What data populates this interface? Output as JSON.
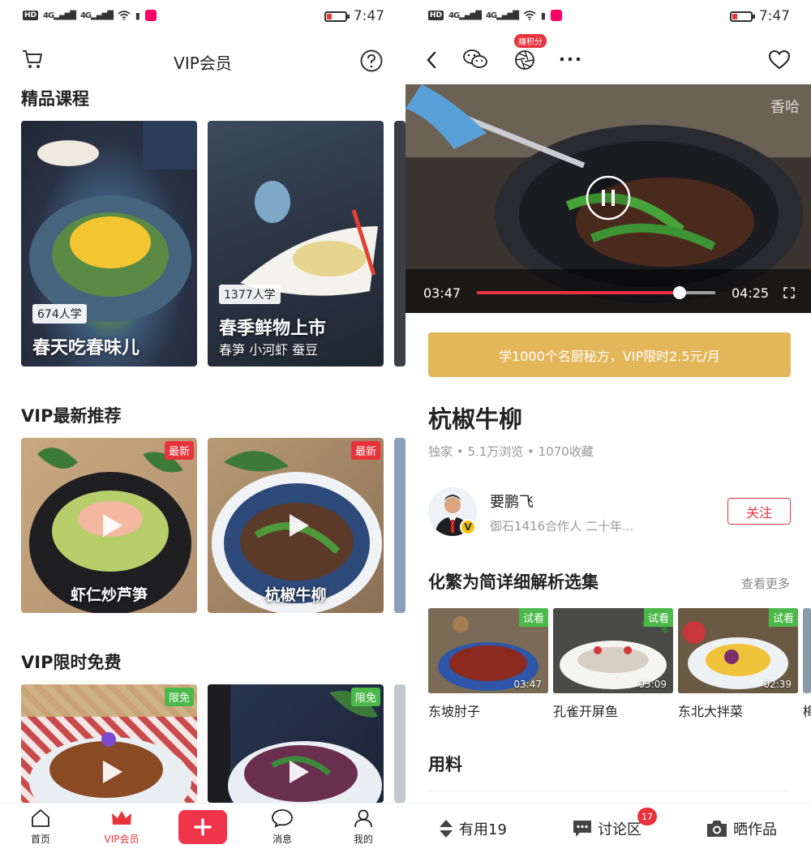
{
  "status": {
    "time": "7:47",
    "hd": "HD",
    "net1": "4G",
    "net2": "4G"
  },
  "left": {
    "nav_title": "VIP会员",
    "section1": "精品课程",
    "courses": [
      {
        "learners": "674人学",
        "title": "春天吃春味儿",
        "sub": ""
      },
      {
        "learners": "1377人学",
        "title": "春季鲜物上市",
        "sub": "春笋 小河虾 蚕豆"
      }
    ],
    "section2": "VIP最新推荐",
    "newest": [
      {
        "badge": "最新",
        "title": "虾仁炒芦笋"
      },
      {
        "badge": "最新",
        "title": "杭椒牛柳"
      }
    ],
    "section3": "VIP限时免费",
    "free": [
      {
        "badge": "限免"
      },
      {
        "badge": "限免"
      }
    ],
    "tabs": [
      {
        "label": "首页",
        "icon": "home-icon"
      },
      {
        "label": "VIP会员",
        "icon": "crown-icon"
      },
      {
        "label": "消息",
        "icon": "message-icon"
      },
      {
        "label": "我的",
        "icon": "user-icon"
      }
    ],
    "colors": {
      "accent": "#e8333c",
      "free": "#4cb84a"
    }
  },
  "right": {
    "earn_badge": "赚积分",
    "video": {
      "watermark": "香哈",
      "current": "03:47",
      "total": "04:25",
      "progress": 0.85
    },
    "vip_banner": "学1000个名厨秘方，VIP限时2.5元/月",
    "recipe_title": "杭椒牛柳",
    "meta": "独家 • 5.1万浏览 • 1070收藏",
    "author": {
      "name": "要鹏飞",
      "desc": "御石1416合作人 二十年...",
      "badge": "V"
    },
    "follow": "关注",
    "series_title": "化繁为简详细解析选集",
    "see_more": "查看更多",
    "series": [
      {
        "tag": "试看",
        "duration": "03:47",
        "label": "东坡肘子"
      },
      {
        "tag": "试看",
        "duration": "03:09",
        "label": "孔雀开屏鱼"
      },
      {
        "tag": "试看",
        "duration": "02:39",
        "label": "东北大拌菜"
      }
    ],
    "peek_label": "梅",
    "ingredients": "用料",
    "actions": {
      "useful": "有用19",
      "discuss": "讨论区",
      "discuss_count": "17",
      "share": "晒作品"
    },
    "colors": {
      "banner": "#e3b65a"
    }
  }
}
